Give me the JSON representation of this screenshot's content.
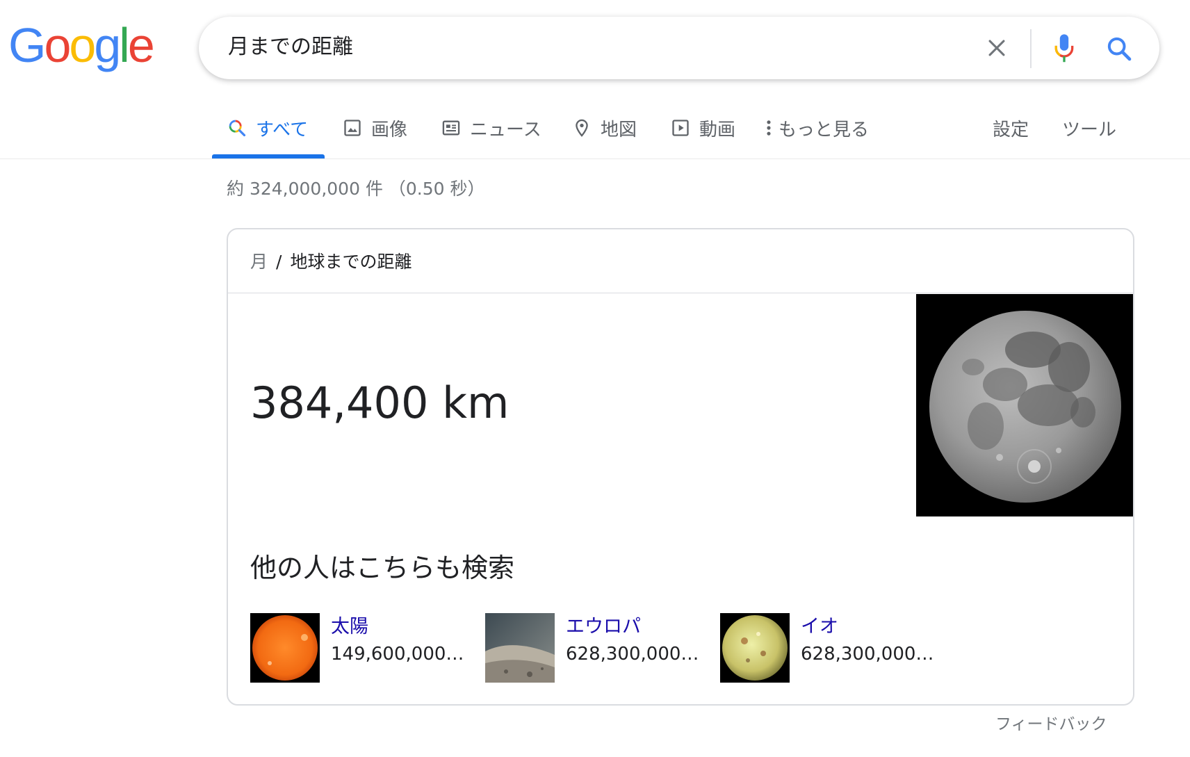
{
  "logo": {
    "letters": [
      "G",
      "o",
      "o",
      "g",
      "l",
      "e"
    ]
  },
  "search": {
    "query": "月までの距離",
    "clear_icon": "close-icon",
    "mic_icon": "mic-icon",
    "search_icon": "search-icon"
  },
  "tabs": [
    {
      "label": "すべて",
      "icon": "search-icon",
      "active": true
    },
    {
      "label": "画像",
      "icon": "image-icon",
      "active": false
    },
    {
      "label": "ニュース",
      "icon": "news-icon",
      "active": false
    },
    {
      "label": "地図",
      "icon": "map-pin-icon",
      "active": false
    },
    {
      "label": "動画",
      "icon": "video-icon",
      "active": false
    },
    {
      "label": "もっと見る",
      "icon": "more-vert-icon",
      "active": false
    }
  ],
  "settings_label": "設定",
  "tools_label": "ツール",
  "result_stats": "約 324,000,000 件 （0.50 秒）",
  "card": {
    "breadcrumb_root": "月",
    "breadcrumb_sep": "/",
    "breadcrumb_current": "地球までの距離",
    "answer": "384,400 km",
    "also_heading": "他の人はこちらも検索",
    "related": [
      {
        "title": "太陽",
        "value": "149,600,000…"
      },
      {
        "title": "エウロパ",
        "value": "628,300,000…"
      },
      {
        "title": "イオ",
        "value": "628,300,000…"
      }
    ]
  },
  "feedback_label": "フィードバック",
  "colors": {
    "google_blue": "#4285F4",
    "google_red": "#EA4335",
    "google_yellow": "#FBBC05",
    "google_green": "#34A853",
    "active_tab": "#1a73e8",
    "link": "#1a0dab"
  }
}
